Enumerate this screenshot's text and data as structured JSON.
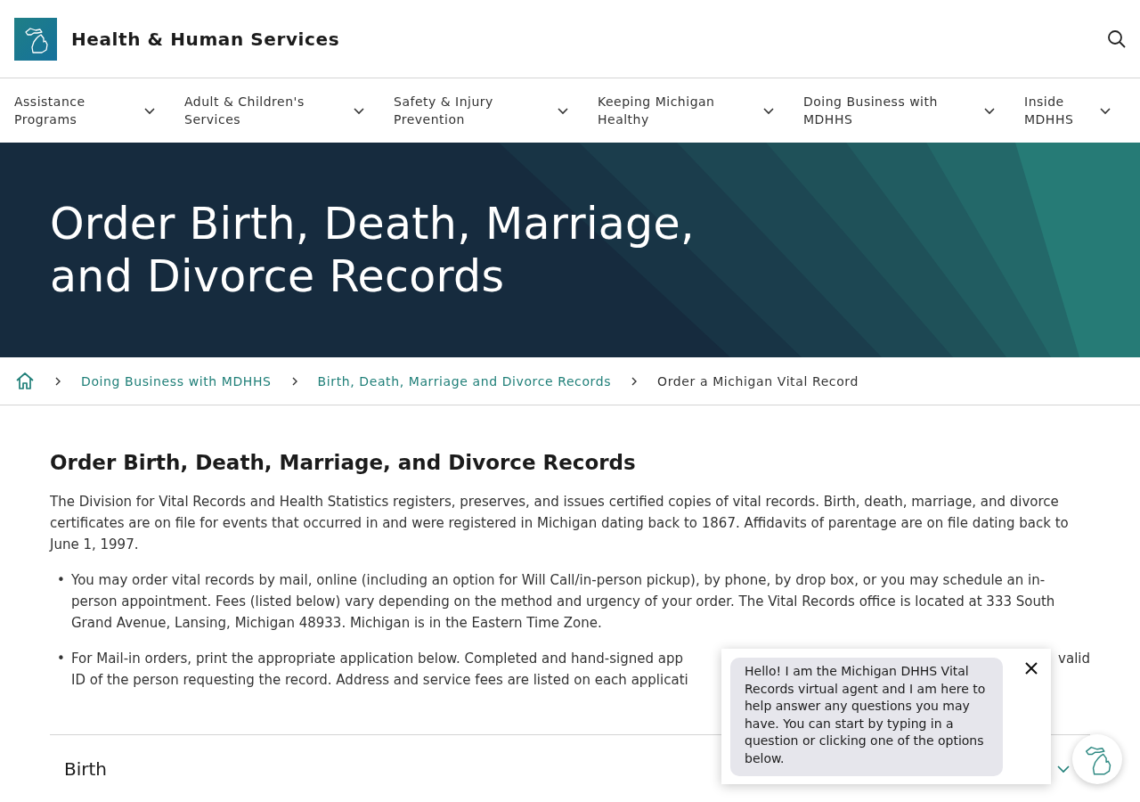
{
  "header": {
    "title": "Health & Human Services"
  },
  "nav": [
    {
      "label": "Assistance Programs"
    },
    {
      "label": "Adult & Children's Services"
    },
    {
      "label": "Safety & Injury Prevention"
    },
    {
      "label": "Keeping Michigan Healthy"
    },
    {
      "label": "Doing Business with MDHHS"
    },
    {
      "label": "Inside MDHHS"
    }
  ],
  "hero": {
    "title": "Order Birth, Death, Marriage, and Divorce Records"
  },
  "breadcrumb": [
    {
      "label": "Doing Business with MDHHS",
      "kind": "link"
    },
    {
      "label": "Birth, Death, Marriage and Divorce Records",
      "kind": "link"
    },
    {
      "label": "Order a Michigan Vital Record",
      "kind": "current"
    }
  ],
  "content": {
    "heading": "Order Birth, Death, Marriage, and Divorce Records",
    "intro": "The Division for Vital Records and Health Statistics registers, preserves, and issues certified copies of vital records. Birth, death, marriage, and divorce certificates are on file for events that occurred in and were registered in Michigan dating back to 1867. Affidavits of parentage are on file dating back to June 1, 1997.",
    "bullets": [
      {
        "kind": "full",
        "marker": "•",
        "text": "You may order vital records by mail, online (including an option for Will Call/in-person pickup), by phone, by drop box, or you may schedule an in-person appointment. Fees (listed below) vary depending on the method and urgency of your order. The Vital Records office is located at 333 South Grand Avenue, Lansing, Michigan 48933. Michigan is in the Eastern Time Zone."
      },
      {
        "kind": "covered",
        "marker": "•",
        "line_1_start": "For Mail-in orders, print the appropriate application below. Completed and hand-signed app",
        "line_1_end": "valid",
        "line_2": "ID of the person requesting the record. Address and service fees are listed on each applicati"
      }
    ]
  },
  "accordion": [
    {
      "label": "Birth",
      "expanded": false
    }
  ],
  "chat": {
    "message": "Hello! I am the Michigan DHHS Vital Records virtual agent and I am here to help answer any questions you may have. You can start by typing in a question or clicking one of the options below."
  }
}
